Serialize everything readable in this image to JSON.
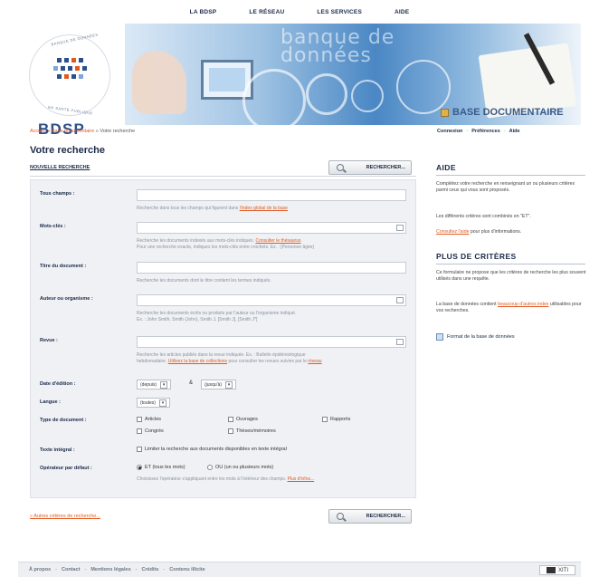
{
  "topnav": {
    "items": [
      "LA BDSP",
      "LE RÉSEAU",
      "LES SERVICES",
      "AIDE"
    ]
  },
  "logo": {
    "text": "BDSP",
    "ring_top": "BANQUE DE DONNÉES",
    "ring_bottom": "EN SANTÉ PUBLIQUE",
    "colors": [
      "#2c4f8a",
      "#e05a20",
      "#7fa6d6"
    ]
  },
  "banner": {
    "overlay_text_line1": "banque de",
    "overlay_text_line2": "données"
  },
  "section_title": "BASE DOCUMENTAIRE",
  "breadcrumb": {
    "home": "Accueil",
    "sep": "»",
    "level1": "Base documentaire",
    "current": "Votre recherche"
  },
  "userlinks": {
    "connexion": "Connexion",
    "preferences": "Préférences",
    "aide": "Aide",
    "sep": "-"
  },
  "page": {
    "title": "Votre recherche",
    "new_search": "NOUVELLE RECHERCHE",
    "search_button": "RECHERCHER...",
    "more_criteria": "» Autres critères de recherche..."
  },
  "form": {
    "all_fields": {
      "label": "Tous champs :",
      "value": "",
      "help_pre": "Recherche dans tous les champs qui figurent dans ",
      "help_link": "l'index global de la base"
    },
    "keywords": {
      "label": "Mots-clés :",
      "value": "",
      "help_line1_pre": "Recherche les documents indexés aux mots-clés indiqués. ",
      "help_link": "Consulter le thésaurus",
      "help_line2": "Pour une recherche exacte, indiquez les mots-clés entre crochets. Ex. : [Personne âgée]"
    },
    "doc_title": {
      "label": "Titre du document :",
      "value": "",
      "help": "Recherche les documents dont le titre contient les termes indiqués."
    },
    "author": {
      "label": "Auteur ou organisme :",
      "value": "",
      "help_line1": "Recherche les documents écrits ou produits par l'auteur ou l'organisme indiqué.",
      "help_line2": "Ex. : John Smith, Smith (John), Smith J, [Smith J], [Smith J*]"
    },
    "journal": {
      "label": "Revue :",
      "value": "",
      "help_line1": "Recherche les articles publiés dans la revue indiquée. Ex. : Bulletin épidémiologique",
      "help_line2_pre": "hebdomadaire. ",
      "help_link": "Utilisez la base de collections",
      "help_line2_post": " pour consulter les revues suivies par le ",
      "help_link2": "réseau"
    },
    "edition_date": {
      "label": "Date d'édition :",
      "from": "(depuis)",
      "amp": "&",
      "to": "(jusqu'à)"
    },
    "language": {
      "label": "Langue :",
      "value": "(toutes)"
    },
    "doc_type": {
      "label": "Type de document :",
      "options": [
        "Articles",
        "Ouvrages",
        "Rapports",
        "Congrès",
        "Thèses/mémoires"
      ]
    },
    "full_text": {
      "label": "Texte intégral :",
      "option": "Limiter la recherche aux documents disponibles en texte intégral"
    },
    "default_operator": {
      "label": "Opérateur par défaut :",
      "option_et": "ET (tous les mots)",
      "option_ou": "OU (un ou plusieurs mots)",
      "help_pre": "Choisissez l'opérateur s'appliquant entre les mots à l'intérieur des champs. ",
      "help_link": "Plus d'infos..."
    }
  },
  "side": {
    "aide_title": "AIDE",
    "aide_p1": "Complétez votre recherche en renseignant un ou plusieurs critères parmi ceux qui vous sont proposés.",
    "aide_p2": "Les différents critères sont combinés en \"ET\".",
    "aide_p3_link": "Consultez l'aide",
    "aide_p3_post": " pour plus d'informations.",
    "plus_title": "PLUS DE CRITÈRES",
    "plus_p1": "Ce formulaire ne propose que les critères de recherche les plus souvent utilisés dans une requête.",
    "plus_p2_pre": "La base de données contient ",
    "plus_p2_link": "beaucoup d'autres index",
    "plus_p2_post": " utilisables pour vos recherches.",
    "format_link": "Format de la base de données"
  },
  "footer": {
    "links": [
      "À propos",
      "Contact",
      "Mentions légales",
      "Crédits",
      "Contenu illicite"
    ],
    "badge": "XITI"
  }
}
